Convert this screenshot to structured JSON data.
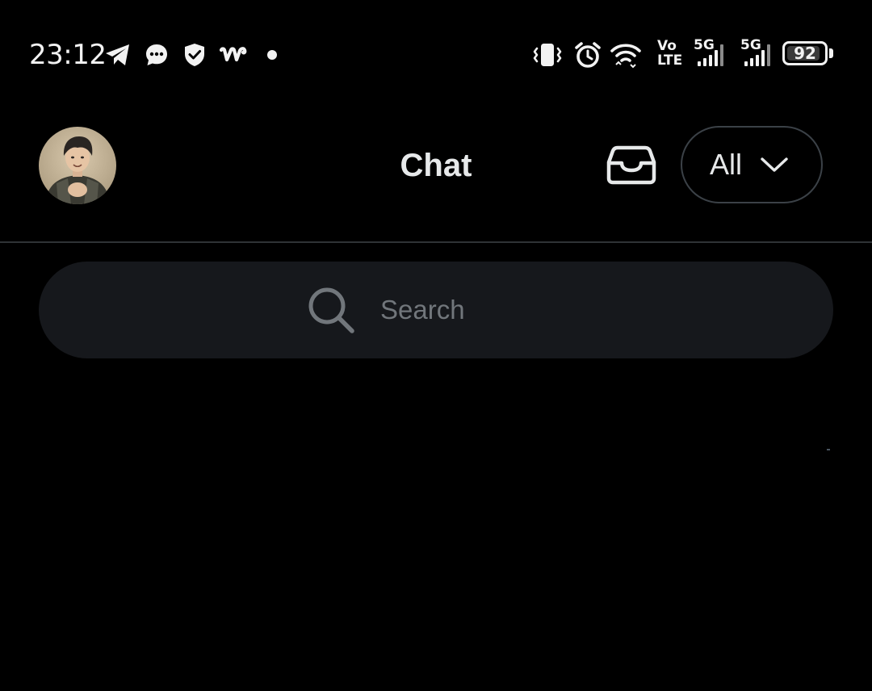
{
  "status_bar": {
    "time": "23:12",
    "notification_icons": [
      "telegram-icon",
      "chat-bubble-icon",
      "shield-check-icon",
      "webtoon-w-icon",
      "dot-icon"
    ],
    "system_icons": [
      "vibrate-icon",
      "alarm-icon",
      "wifi-icon",
      "volte-icon",
      "signal-5g-icon",
      "signal-5g-icon"
    ],
    "volte": {
      "top": "Vo",
      "bottom": "LTE"
    },
    "network_1": "5G",
    "network_2": "5G",
    "battery": {
      "level": 92,
      "label": "92"
    }
  },
  "header": {
    "title": "Chat",
    "filter": {
      "selected": "All"
    },
    "icons": [
      "avatar",
      "inbox-tray-icon",
      "chevron-down-icon"
    ]
  },
  "search": {
    "placeholder": "Search",
    "value": ""
  },
  "colors": {
    "background": "#000000",
    "text": "#e7e9ea",
    "muted": "#71767b",
    "search_bg": "#16181c",
    "border": "#2f3336"
  }
}
